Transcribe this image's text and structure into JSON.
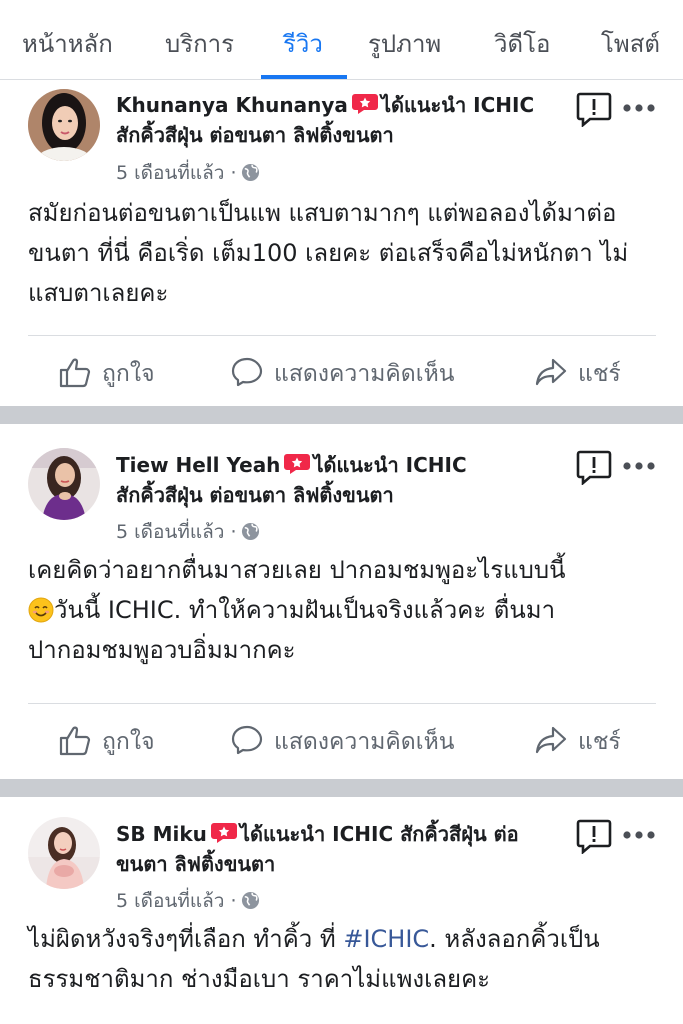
{
  "tabs": [
    {
      "label": "หน้าหลัก",
      "active": false
    },
    {
      "label": "บริการ",
      "active": false
    },
    {
      "label": "รีวิว",
      "active": true
    },
    {
      "label": "รูปภาพ",
      "active": false
    },
    {
      "label": "วิดีโอ",
      "active": false
    },
    {
      "label": "โพสต์",
      "active": false
    }
  ],
  "colors": {
    "accent": "#1877f2",
    "recommend": "#f02849",
    "text": "#1c1e21",
    "muted": "#606770",
    "separator": "#c9ccd1",
    "hashtag": "#385898"
  },
  "reviews": [
    {
      "name": "Khunanya Khunanya",
      "recommend_text": "ได้แนะนำ ICHIC",
      "page_name": "สักคิ้วสีฝุ่น ต่อขนตา ลิฟติ้งขนตา",
      "time": "5 เดือนที่แล้ว ·",
      "text": "สมัยก่อนต่อขนตาเป็นแพ  แสบตามากๆ แต่พอลองได้มาต่อขนตา ที่นี่ คือเริ่ด  เต็ม100 เลยคะ ต่อเสร็จคือไม่หนักตา ไม่แสบตาเลยคะ",
      "icons": [
        "recommend-icon",
        "globe-icon",
        "report-icon",
        "more-icon"
      ]
    },
    {
      "name": "Tiew Hell Yeah",
      "recommend_text": "ได้แนะนำ ICHIC",
      "page_name": "สักคิ้วสีฝุ่น ต่อขนตา ลิฟติ้งขนตา",
      "time": "5 เดือนที่แล้ว ·",
      "text_line1": "เคยคิดว่าอยากตื่นมาสวยเลย  ปากอมชมพูอะไรแบบนี้",
      "text_line2": "วันนี้ ICHIC. ทำให้ความฝันเป็นจริงแล้วคะ ตื่นมา",
      "text_line3": "ปากอมชมพูอวบอิ่มมากคะ",
      "icons": [
        "recommend-icon",
        "globe-icon",
        "smiling-face-emoji",
        "report-icon",
        "more-icon"
      ]
    },
    {
      "name": "SB Miku",
      "recommend_text": "ได้แนะนำ ICHIC",
      "page_name": "สักคิ้วสีฝุ่น ต่อขนตา ลิฟติ้งขนตา",
      "time": "5 เดือนที่แล้ว ·",
      "text_before": "ไม่ผิดหวังจริงๆที่เลือก ทำคิ้ว ที่ ",
      "hashtag": "#ICHIC",
      "text_after": ". หลังลอกคิ้วเป็นธรรมชาติมาก  ช่างมือเบา ราคาไม่แพงเลยคะ",
      "icons": [
        "recommend-icon",
        "globe-icon",
        "report-icon",
        "more-icon"
      ]
    }
  ],
  "actions": {
    "like": "ถูกใจ",
    "comment": "แสดงความคิดเห็น",
    "share": "แชร์"
  }
}
